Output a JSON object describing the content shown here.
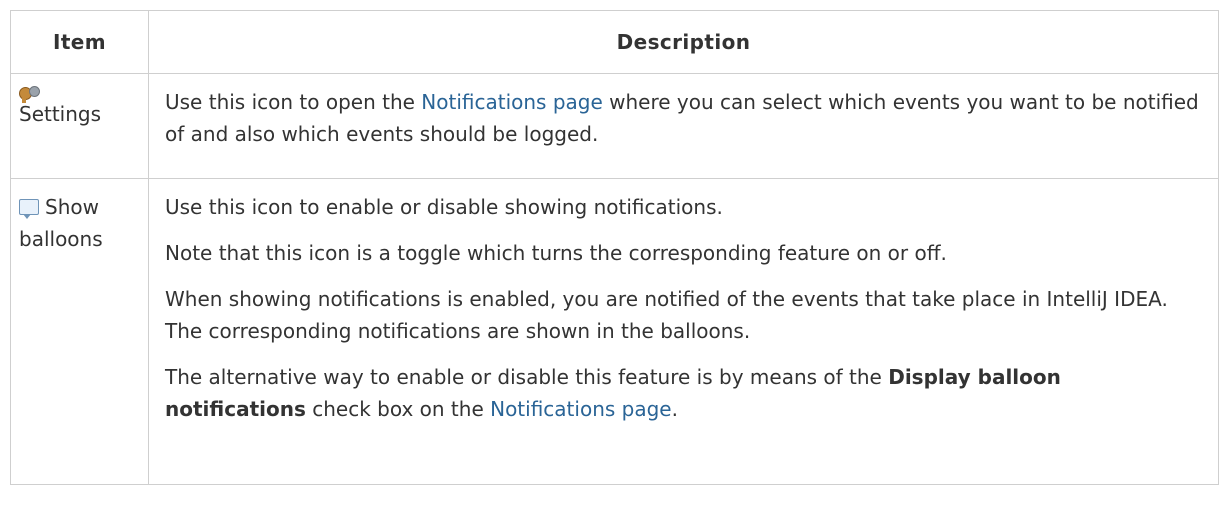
{
  "header": {
    "item": "Item",
    "description": "Description"
  },
  "rows": [
    {
      "item_label": "Settings",
      "icon": "settings-gears-icon",
      "desc": {
        "pre": "Use this icon to open the ",
        "link": "Notifications page",
        "post": " where you can select which events you want to be notified of and also which events should be logged."
      }
    },
    {
      "item_label": "Show balloons",
      "icon": "balloon-icon",
      "p1": "Use this icon to enable or disable showing notifications.",
      "p2": "Note that this icon is a toggle which turns the corresponding feature on or off.",
      "p3": "When showing notifications is enabled, you are notified of the events that take place in IntelliJ IDEA. The corresponding notifications are shown in the balloons.",
      "p4": {
        "pre": "The alternative way to enable or disable this feature is by means of the ",
        "bold": "Display balloon notifications",
        "mid": " check box on the ",
        "link": "Notifications page",
        "post": "."
      }
    }
  ],
  "colors": {
    "link": "#2a6496",
    "border": "#cfcfcf",
    "text": "#333333"
  }
}
